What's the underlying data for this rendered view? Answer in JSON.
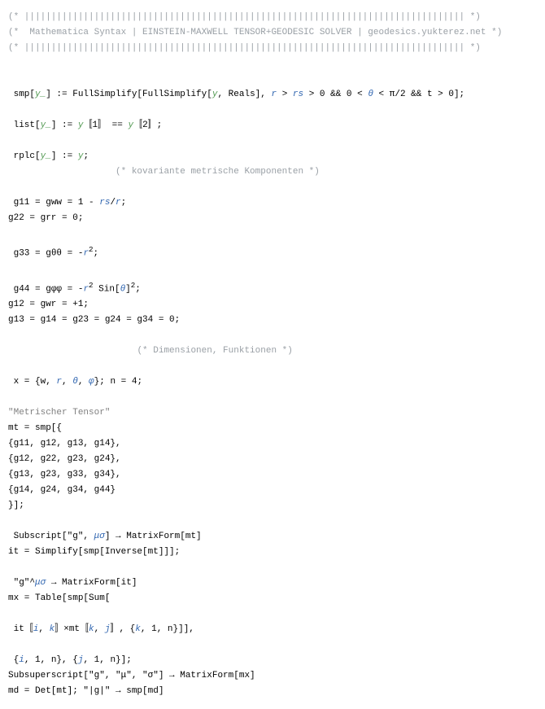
{
  "header": {
    "top": "(* |||||||||||||||||||||||||||||||||||||||||||||||||||||||||||||||||||||||||||||||||| *)",
    "mid": "(*  Mathematica Syntax | EINSTEIN-MAXWELL TENSOR+GEODESIC SOLVER | geodesics.yukterez.net *)",
    "bot": "(* |||||||||||||||||||||||||||||||||||||||||||||||||||||||||||||||||||||||||||||||||| *)"
  },
  "l": {
    "smp_pre": "smp[",
    "smp_arg": "y_",
    "smp_mid1": "] := FullSimplify[FullSimplify[",
    "smp_y": "y",
    "smp_mid2": ", Reals], ",
    "smp_r": "r",
    "smp_gt": " > ",
    "smp_rs": "rs",
    "smp_cnd": " > 0 && 0 < ",
    "smp_th": "θ",
    "smp_pi": " < π/2 && t > 0];",
    "list_pre": "list[",
    "list_arg": "y_",
    "list_mid": "] := ",
    "list_y": "y",
    "list_b1": "〚1〛 == ",
    "list_b2": "〚2〛;",
    "rplc_pre": "rplc[",
    "rplc_arg": "y_",
    "rplc_mid": "] := ",
    "rplc_y": "y",
    "rplc_end": ";",
    "cm1_pad": "                    ",
    "cm1": "(* kovariante metrische Komponenten *)",
    "g11_a": "g11 = gww = 1 - ",
    "g11_rs": "rs",
    "g11_sl": "/",
    "g11_r": "r",
    "g11_e": ";",
    "g22": "g22 = grr = 0;",
    "g33_a": "g33 = gθθ = -",
    "g33_r": "r",
    "g33_e": ";",
    "g44_a": "g44 = gφφ = -",
    "g44_r": "r",
    "g44_s": " Sin[",
    "g44_t": "θ",
    "g44_c": "]",
    "g44_e": ";",
    "g12": "g12 = gwr = +1;",
    "gz": "g13 = g14 = g23 = g24 = g34 = 0;",
    "cm2_pad": "                        ",
    "cm2": "(* Dimensionen, Funktionen *)",
    "x_a": "x = {w, ",
    "x_r": "r",
    "x_c1": ", ",
    "x_th": "θ",
    "x_c2": ", ",
    "x_ph": "φ",
    "x_e": "}; n = 4;",
    "mt_title": "\"Metrischer Tensor\"",
    "mt_open": "mt = smp[{",
    "mt_r1": "{g11, g12, g13, g14},",
    "mt_r2": "{g12, g22, g23, g24},",
    "mt_r3": "{g13, g23, g33, g34},",
    "mt_r4": "{g14, g24, g34, g44}",
    "mt_close": "}];",
    "sub_a": "Subscript[\"g\", ",
    "sub_ms": "μσ",
    "sub_b": "] → MatrixForm[mt]",
    "it": "it = Simplify[smp[Inverse[mt]]];",
    "gup_a": "\"g\"^",
    "gup_ms": "μσ",
    "gup_b": " → MatrixForm[it]",
    "mx1": "mx = Table[smp[Sum[",
    "mx2_a": "it〚",
    "mx2_i": "i",
    "mx2_c1": ", ",
    "mx2_k": "k",
    "mx2_b": "〛×mt〚",
    "mx2_k2": "k",
    "mx2_c2": ", ",
    "mx2_j": "j",
    "mx2_e": "〛, {",
    "mx2_k3": "k",
    "mx2_f": ", 1, n}]],",
    "mx3_a": "{",
    "mx3_i": "i",
    "mx3_m": ", 1, n}, {",
    "mx3_j": "j",
    "mx3_e": ", 1, n}];",
    "ssc": "Subsuperscript[\"g\", \"μ\", \"σ\"] → MatrixForm[mx]",
    "md": "md = Det[mt]; \"|g|\" → smp[md]"
  }
}
